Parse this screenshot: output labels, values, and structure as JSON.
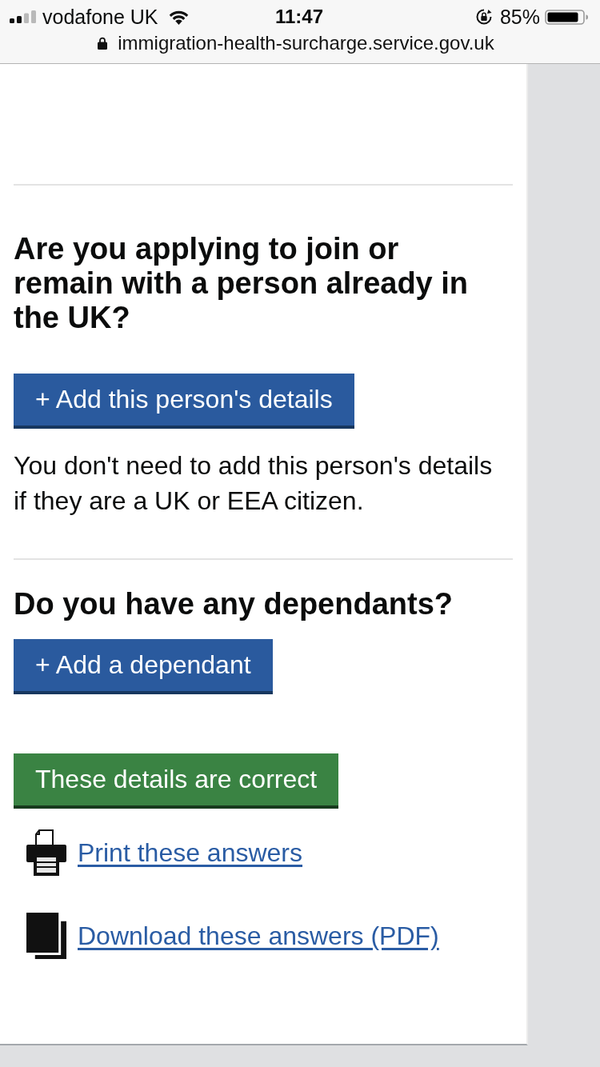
{
  "status_bar": {
    "carrier": "vodafone UK",
    "time": "11:47",
    "battery_percent": "85%"
  },
  "address_bar": {
    "url": "immigration-health-surcharge.service.gov.uk"
  },
  "sections": [
    {
      "heading": "Are you applying to join or remain with a person already in the UK?",
      "button": {
        "label": "+ Add this person's details"
      },
      "hint": "You don't need to add this person's details if they are a UK or EEA citizen."
    },
    {
      "heading": "Do you have any dependants?",
      "button": {
        "label": "+ Add a dependant"
      }
    }
  ],
  "confirm_button": {
    "label": "These details are correct"
  },
  "links": [
    {
      "kind": "print",
      "label": "Print these answers"
    },
    {
      "kind": "download",
      "label": "Download these answers (PDF)"
    }
  ]
}
